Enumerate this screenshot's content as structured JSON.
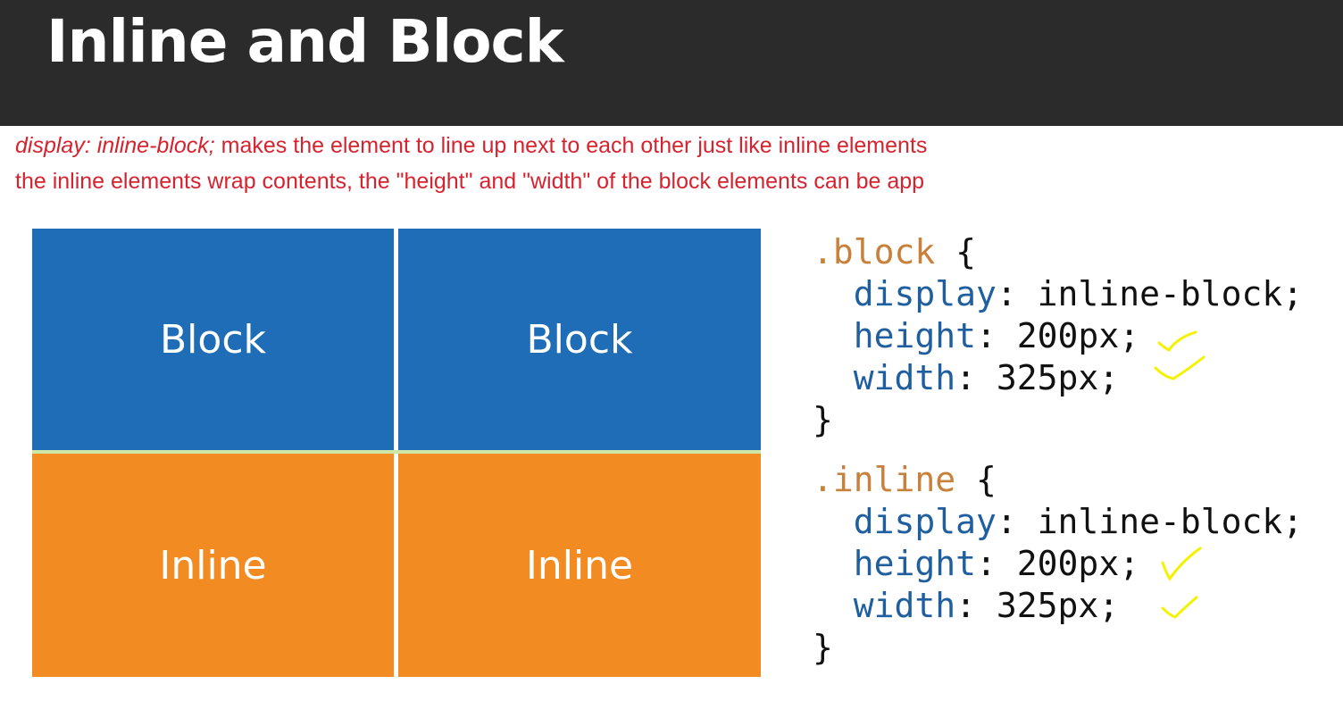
{
  "header": {
    "title": "Inline and Block"
  },
  "note": {
    "line1_italic": "display: inline-block;",
    "line1_rest": " makes the element to line up next to each other just like inline elements",
    "line2": "the inline elements wrap contents, the \"height\" and \"width\" of the block elements can be app"
  },
  "boxes": {
    "block_label": "Block",
    "inline_label": "Inline"
  },
  "code": {
    "block_rule": {
      "selector": ".block",
      "open": " {",
      "display_prop": "display",
      "display_val": ": inline-block;",
      "height_prop": "height",
      "height_val": ": 200px;",
      "width_prop": "width",
      "width_val": ": 325px;",
      "close": "}"
    },
    "inline_rule": {
      "selector": ".inline",
      "open": " {",
      "display_prop": "display",
      "display_val": ": inline-block;",
      "height_prop": "height",
      "height_val": ": 200px;",
      "width_prop": "width",
      "width_val": ": 325px;",
      "close": "}"
    }
  },
  "colors": {
    "header_bg": "#2b2b2c",
    "note_text": "#d5232f",
    "block_blue": "#1f6db7",
    "inline_orange": "#f28b22",
    "selector": "#c9803a",
    "property": "#1f5fa0",
    "checkmark": "#f5f200"
  },
  "annotations": {
    "checkmark_icon": "checkmark-icon"
  }
}
